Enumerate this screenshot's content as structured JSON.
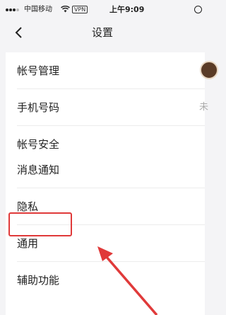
{
  "status_bar": {
    "carrier": "中国移动",
    "vpn": "VPN",
    "time": "上午9:09"
  },
  "nav": {
    "title": "设置"
  },
  "group1": [
    {
      "label": "帐号管理"
    },
    {
      "label": "手机号码",
      "value": "未"
    },
    {
      "label": "帐号安全"
    }
  ],
  "group2": [
    {
      "label": "消息通知"
    },
    {
      "label": "隐私"
    },
    {
      "label": "通用"
    },
    {
      "label": "辅助功能"
    }
  ],
  "annotation": {
    "color": "#e03a3a"
  }
}
